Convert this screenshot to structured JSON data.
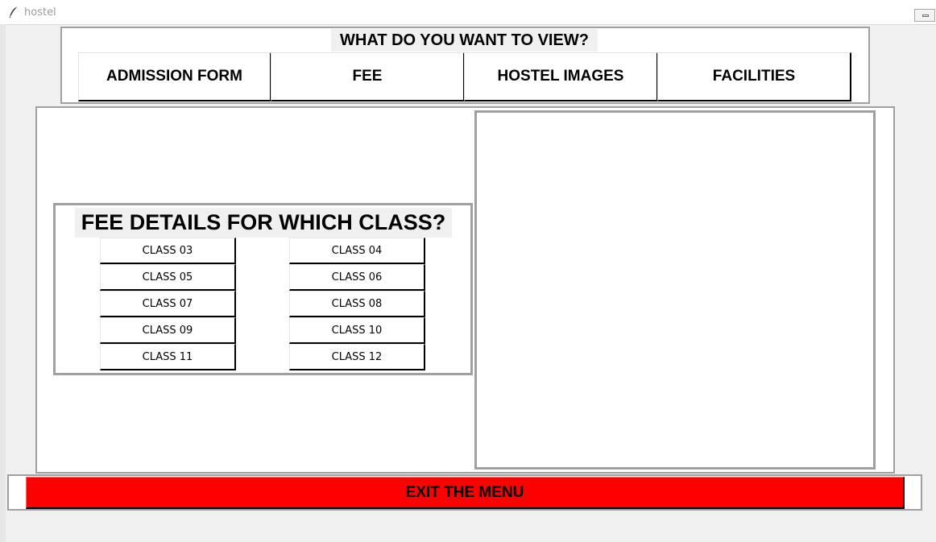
{
  "window": {
    "title": "hostel",
    "icon": "feather-icon"
  },
  "top_panel": {
    "heading": "WHAT DO YOU WANT TO VIEW?",
    "buttons": [
      {
        "label": "ADMISSION FORM"
      },
      {
        "label": "FEE"
      },
      {
        "label": "HOSTEL IMAGES"
      },
      {
        "label": "FACILITIES"
      }
    ]
  },
  "fee_panel": {
    "heading": "FEE DETAILS FOR WHICH CLASS?",
    "classes": [
      {
        "label": "CLASS 03"
      },
      {
        "label": "CLASS 04"
      },
      {
        "label": "CLASS 05"
      },
      {
        "label": "CLASS 06"
      },
      {
        "label": "CLASS 07"
      },
      {
        "label": "CLASS 08"
      },
      {
        "label": "CLASS 09"
      },
      {
        "label": "CLASS 10"
      },
      {
        "label": "CLASS 11"
      },
      {
        "label": "CLASS 12"
      }
    ]
  },
  "exit": {
    "label": "EXIT THE MENU",
    "color": "#ff0000"
  }
}
